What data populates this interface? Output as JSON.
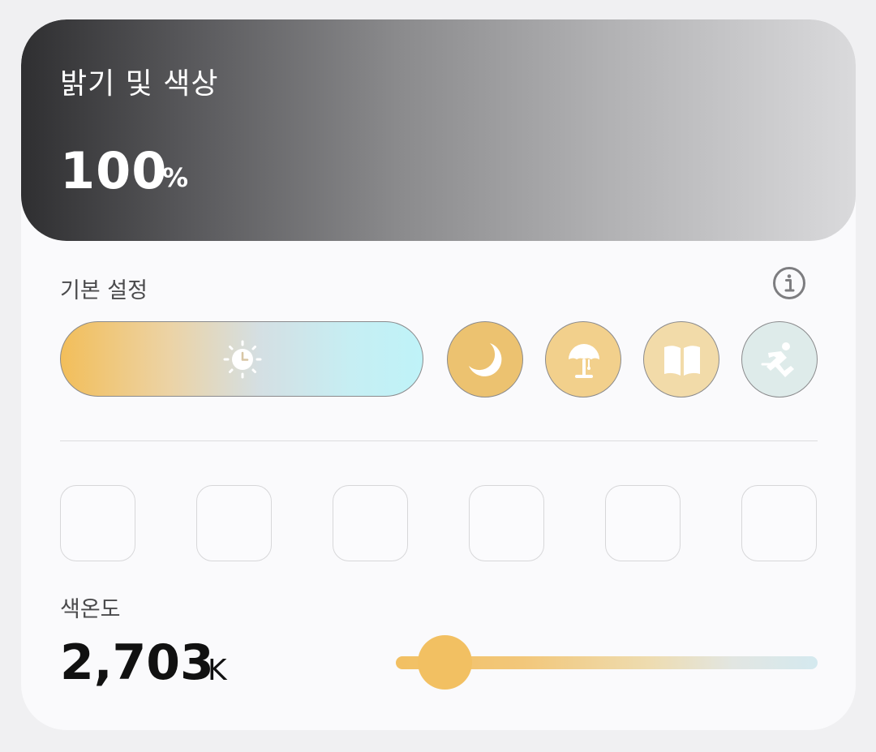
{
  "brightness": {
    "title": "밝기 및 색상",
    "value": "100",
    "unit": "%",
    "gradient_colors": [
      "#2f2f31",
      "#dadadc"
    ]
  },
  "presets": {
    "label": "기본 설정",
    "info_icon": "info-circle-icon",
    "daily": {
      "icon": "sun-clock-icon",
      "colors": [
        "#f2be5a",
        "#bff3f8"
      ]
    },
    "modes": [
      {
        "name": "night",
        "icon": "moon-icon",
        "color": "#ecc270"
      },
      {
        "name": "relax",
        "icon": "lamp-icon",
        "color": "#f2d08c"
      },
      {
        "name": "reading",
        "icon": "book-icon",
        "color": "#f2dba9"
      },
      {
        "name": "energy",
        "icon": "running-icon",
        "color": "#deebea"
      }
    ]
  },
  "color_slots": [
    {
      "color": ""
    },
    {
      "color": ""
    },
    {
      "color": ""
    },
    {
      "color": ""
    },
    {
      "color": ""
    },
    {
      "color": ""
    }
  ],
  "color_temperature": {
    "label": "색온도",
    "value": "2,703",
    "unit": "K",
    "slider_fraction": 0.12,
    "thumb_color": "#f2c062"
  }
}
